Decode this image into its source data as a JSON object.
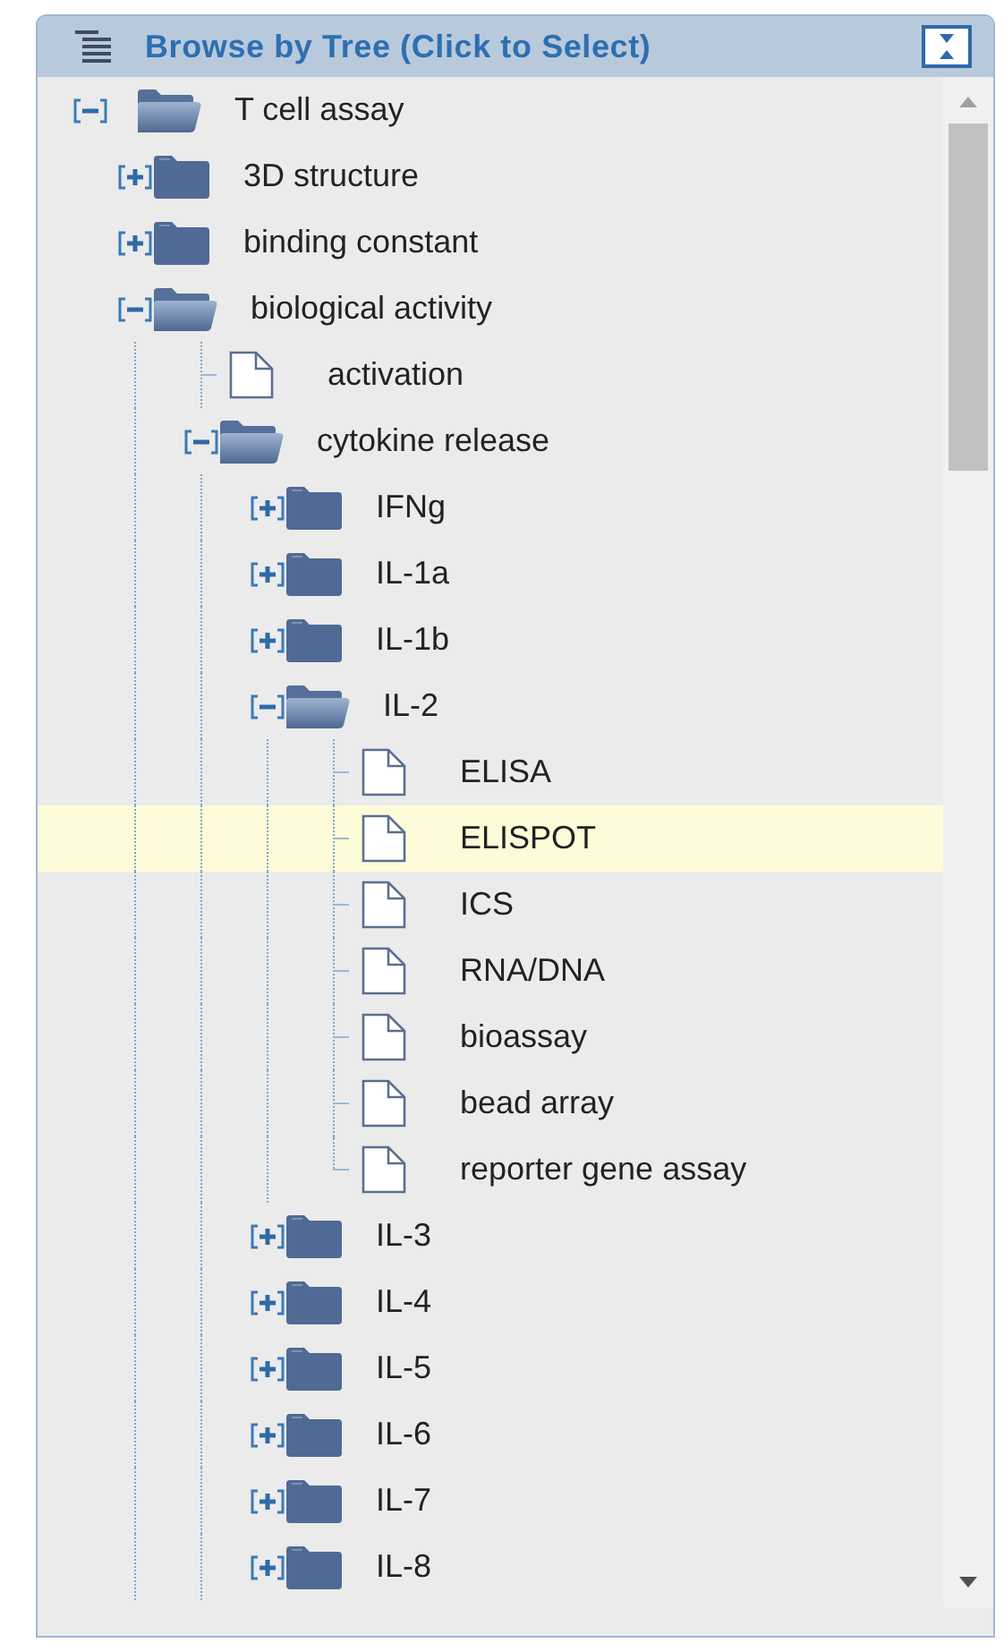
{
  "panel": {
    "title": "Browse by Tree (Click to Select)"
  },
  "tree": [
    {
      "label": "T cell assay",
      "kind": "folder",
      "expanded": true,
      "selected": false,
      "children": [
        {
          "label": "3D structure",
          "kind": "folder",
          "expanded": false,
          "selected": false
        },
        {
          "label": "binding constant",
          "kind": "folder",
          "expanded": false,
          "selected": false
        },
        {
          "label": "biological activity",
          "kind": "folder",
          "expanded": true,
          "selected": false,
          "children": [
            {
              "label": "activation",
              "kind": "leaf",
              "selected": false
            },
            {
              "label": "cytokine release",
              "kind": "folder",
              "expanded": true,
              "selected": false,
              "children": [
                {
                  "label": "IFNg",
                  "kind": "folder",
                  "expanded": false,
                  "selected": false
                },
                {
                  "label": "IL-1a",
                  "kind": "folder",
                  "expanded": false,
                  "selected": false
                },
                {
                  "label": "IL-1b",
                  "kind": "folder",
                  "expanded": false,
                  "selected": false
                },
                {
                  "label": "IL-2",
                  "kind": "folder",
                  "expanded": true,
                  "selected": false,
                  "children": [
                    {
                      "label": "ELISA",
                      "kind": "leaf",
                      "selected": false
                    },
                    {
                      "label": "ELISPOT",
                      "kind": "leaf",
                      "selected": true
                    },
                    {
                      "label": "ICS",
                      "kind": "leaf",
                      "selected": false
                    },
                    {
                      "label": "RNA/DNA",
                      "kind": "leaf",
                      "selected": false
                    },
                    {
                      "label": "bioassay",
                      "kind": "leaf",
                      "selected": false
                    },
                    {
                      "label": "bead array",
                      "kind": "leaf",
                      "selected": false
                    },
                    {
                      "label": "reporter gene assay",
                      "kind": "leaf",
                      "selected": false
                    }
                  ]
                },
                {
                  "label": "IL-3",
                  "kind": "folder",
                  "expanded": false,
                  "selected": false
                },
                {
                  "label": "IL-4",
                  "kind": "folder",
                  "expanded": false,
                  "selected": false
                },
                {
                  "label": "IL-5",
                  "kind": "folder",
                  "expanded": false,
                  "selected": false
                },
                {
                  "label": "IL-6",
                  "kind": "folder",
                  "expanded": false,
                  "selected": false
                },
                {
                  "label": "IL-7",
                  "kind": "folder",
                  "expanded": false,
                  "selected": false
                },
                {
                  "label": "IL-8",
                  "kind": "folder",
                  "expanded": false,
                  "selected": false
                }
              ]
            }
          ]
        }
      ]
    }
  ]
}
